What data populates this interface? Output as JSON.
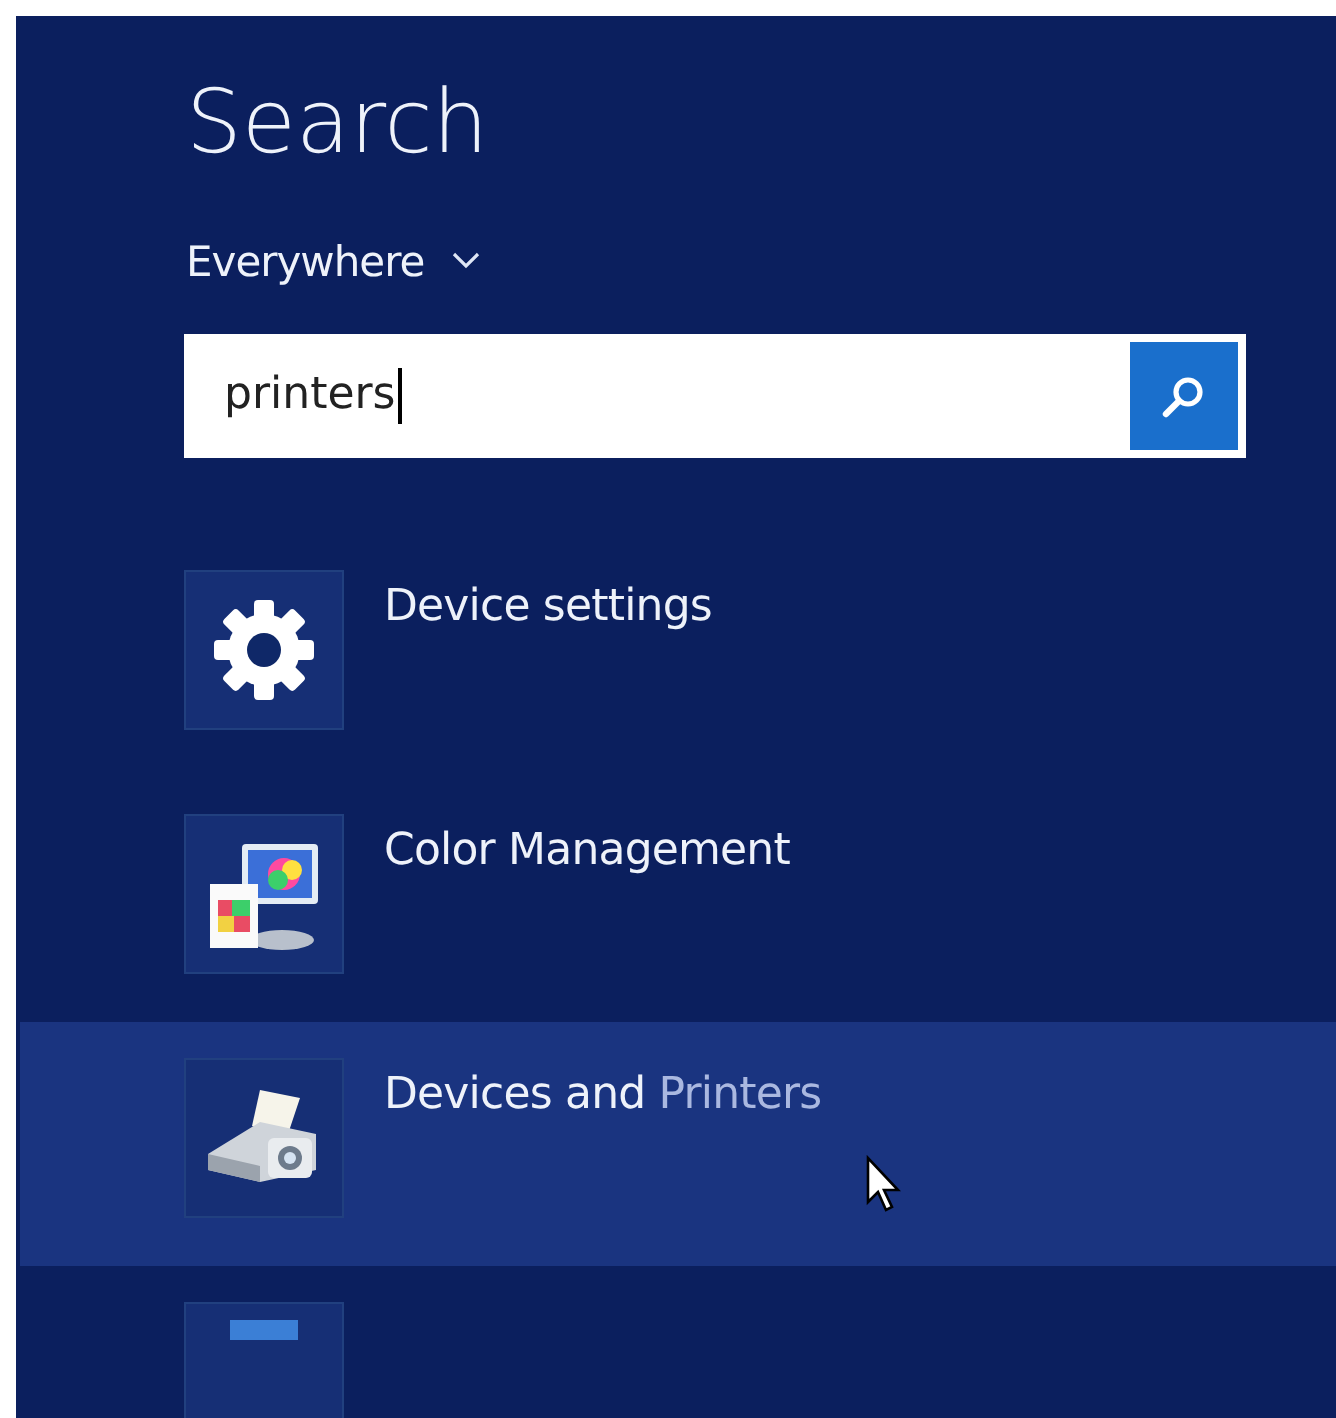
{
  "title": "Search",
  "scope": {
    "label": "Everywhere"
  },
  "search": {
    "value": "printers"
  },
  "results": [
    {
      "kind": "gear",
      "selected": false,
      "parts": [
        {
          "text": "Device settings",
          "match": false
        }
      ]
    },
    {
      "kind": "color",
      "selected": false,
      "parts": [
        {
          "text": "Color Management",
          "match": false
        }
      ]
    },
    {
      "kind": "printer",
      "selected": true,
      "parts": [
        {
          "text": "Devices and ",
          "match": false
        },
        {
          "text": "Printers",
          "match": true
        }
      ]
    },
    {
      "kind": "network",
      "selected": false
    }
  ]
}
